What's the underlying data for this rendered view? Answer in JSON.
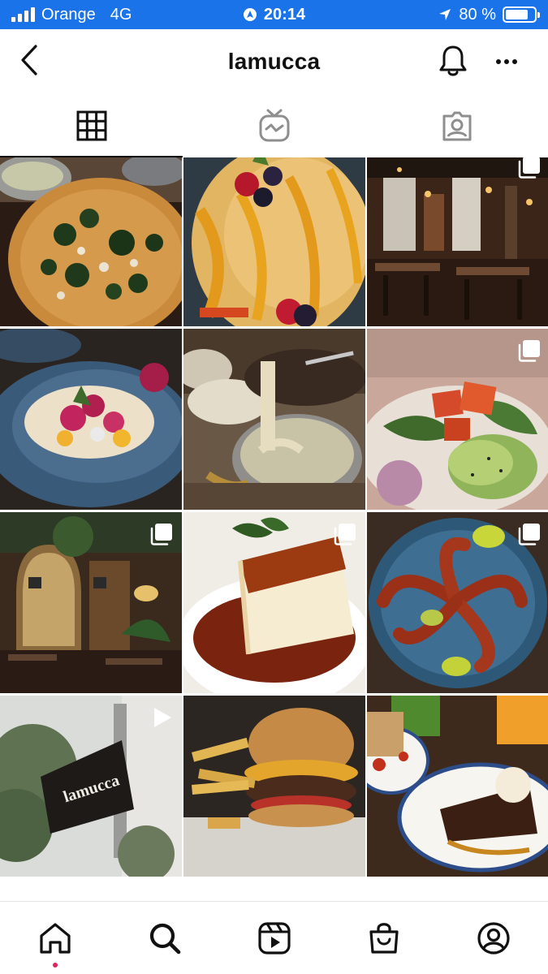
{
  "status_bar": {
    "carrier": "Orange",
    "network": "4G",
    "time": "20:14",
    "battery": "80 %",
    "battery_level": 0.8
  },
  "header": {
    "title": "lamucca"
  },
  "tabs": [
    {
      "name": "grid-icon",
      "active": true
    },
    {
      "name": "igtv-icon",
      "active": false
    },
    {
      "name": "tagged-icon",
      "active": false
    }
  ],
  "posts": [
    {
      "subject": "pizza",
      "type": "photo"
    },
    {
      "subject": "crepes",
      "type": "photo"
    },
    {
      "subject": "restaurant-interior",
      "type": "carousel"
    },
    {
      "subject": "tacos",
      "type": "photo"
    },
    {
      "subject": "fondue",
      "type": "photo"
    },
    {
      "subject": "poke-bowl",
      "type": "carousel"
    },
    {
      "subject": "terrace",
      "type": "carousel"
    },
    {
      "subject": "cheesecake",
      "type": "carousel"
    },
    {
      "subject": "octopus",
      "type": "carousel"
    },
    {
      "subject": "storefront-sign",
      "type": "video",
      "sign_text": "lamucca"
    },
    {
      "subject": "burger",
      "type": "photo"
    },
    {
      "subject": "brownie",
      "type": "photo"
    }
  ],
  "bottom_nav": [
    {
      "name": "home-icon",
      "has_dot": true
    },
    {
      "name": "search-icon",
      "has_dot": false
    },
    {
      "name": "reels-icon",
      "has_dot": false
    },
    {
      "name": "shop-icon",
      "has_dot": false
    },
    {
      "name": "profile-icon",
      "has_dot": false
    }
  ]
}
